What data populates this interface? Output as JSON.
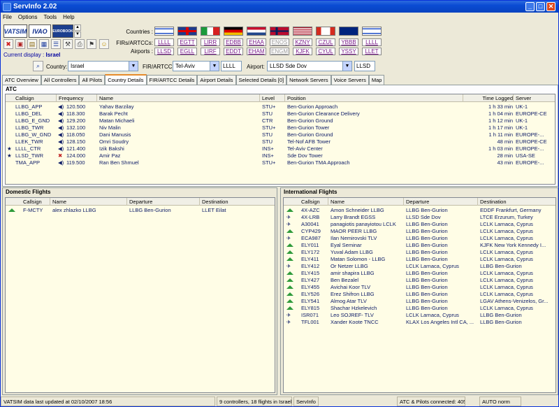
{
  "title": "ServInfo 2.02",
  "menu": [
    "File",
    "Options",
    "Tools",
    "Help"
  ],
  "window_buttons": [
    "_",
    "□",
    "✕"
  ],
  "logos": {
    "vatsim": "VATSIM",
    "ivao": "IVAO",
    "eurobook": "EUROBOOK"
  },
  "labels": {
    "countries": "Countries :",
    "firs": "FIRs/ARTCCs:",
    "airports": "Airports :",
    "current_display": "Current display :",
    "country": "Country:",
    "fir": "FIR/ARTCC:",
    "airport": "Airport:"
  },
  "current_display": "Israel",
  "firs": [
    {
      "code": "LLLL",
      "grey": false
    },
    {
      "code": "EGTT",
      "grey": false
    },
    {
      "code": "LIRR",
      "grey": false
    },
    {
      "code": "EDBB",
      "grey": false
    },
    {
      "code": "EHAA",
      "grey": false
    },
    {
      "code": "ENOS",
      "grey": true
    },
    {
      "code": "KZNY",
      "grey": false
    },
    {
      "code": "CZUL",
      "grey": false
    },
    {
      "code": "YBBB",
      "grey": false
    },
    {
      "code": "LLLL",
      "grey": false
    }
  ],
  "airports": [
    {
      "code": "LLSD",
      "grey": false
    },
    {
      "code": "EGLL",
      "grey": false
    },
    {
      "code": "LIRF",
      "grey": false
    },
    {
      "code": "EDDT",
      "grey": false
    },
    {
      "code": "EHAM",
      "grey": false
    },
    {
      "code": "ENGM",
      "grey": true
    },
    {
      "code": "KJFK",
      "grey": false
    },
    {
      "code": "CYUL",
      "grey": false
    },
    {
      "code": "YSSY",
      "grey": false
    },
    {
      "code": "LLET",
      "grey": false
    }
  ],
  "flags": [
    "israel",
    "uk",
    "italy",
    "germany",
    "netherlands",
    "norway",
    "usa",
    "canada",
    "australia",
    "israel"
  ],
  "filters": {
    "country": "Israel",
    "fir_value": "Tel-Aviv",
    "fir_code": "LLLL",
    "airport_value": "LLSD Sde Dov",
    "airport_code": "LLSD"
  },
  "tabs": [
    {
      "label": "ATC Overview",
      "active": false
    },
    {
      "label": "All Controllers",
      "active": false
    },
    {
      "label": "All Pilots",
      "active": false
    },
    {
      "label": "Country Details",
      "active": true
    },
    {
      "label": "FIR/ARTCC Details",
      "active": false
    },
    {
      "label": "Airport Details",
      "active": false
    },
    {
      "label": "Selected Details [0]",
      "active": false
    },
    {
      "label": "Network Servers",
      "active": false
    },
    {
      "label": "Voice Servers",
      "active": false
    },
    {
      "label": "Map",
      "active": false
    }
  ],
  "atc": {
    "title": "ATC",
    "columns": [
      "Callsign",
      "Frequency",
      "Name",
      "Level",
      "Position",
      "Time Logged",
      "Server"
    ],
    "rows": [
      {
        "star": false,
        "callsign": "LLBG_APP",
        "mute": false,
        "freq": "120.500",
        "name": "Yahav Barzilay",
        "level": "STU+",
        "position": "Ben-Gurion Approach",
        "time": "1 h 33 min",
        "server": "UK-1"
      },
      {
        "star": false,
        "callsign": "LLBG_DEL",
        "mute": false,
        "freq": "118.300",
        "name": "Barak Pecht",
        "level": "STU",
        "position": "Ben-Gurion Clearance Delivery",
        "time": "1 h 04 min",
        "server": "EUROPE-CE"
      },
      {
        "star": false,
        "callsign": "LLBG_E_GND",
        "mute": false,
        "freq": "129.200",
        "name": "Matan Michaeli",
        "level": "CTR",
        "position": "Ben-Gurion Ground",
        "time": "1 h 12 min",
        "server": "UK-1"
      },
      {
        "star": false,
        "callsign": "LLBG_TWR",
        "mute": false,
        "freq": "132.100",
        "name": "Niv Malin",
        "level": "STU+",
        "position": "Ben-Gurion Tower",
        "time": "1 h 17 min",
        "server": "UK-1"
      },
      {
        "star": false,
        "callsign": "LLBG_W_GND",
        "mute": false,
        "freq": "118.050",
        "name": "Dani Manusis",
        "level": "STU",
        "position": "Ben-Gurion Ground",
        "time": "1 h 11 min",
        "server": "EUROPE-..."
      },
      {
        "star": false,
        "callsign": "LLEK_TWR",
        "mute": false,
        "freq": "128.150",
        "name": "Omri Soudry",
        "level": "STU",
        "position": "Tel-Nof AFB Tower",
        "time": "48 min",
        "server": "EUROPE-CE"
      },
      {
        "star": true,
        "callsign": "LLLL_CTR",
        "mute": false,
        "freq": "121.400",
        "name": "Izik Bakshi",
        "level": "INS+",
        "position": "Tel-Aviv Center",
        "time": "1 h 03 min",
        "server": "EUROPE-..."
      },
      {
        "star": true,
        "callsign": "LLSD_TWR",
        "mute": true,
        "freq": "124.000",
        "name": "Amir Paz",
        "level": "INS+",
        "position": "Sde Dov Tower",
        "time": "28 min",
        "server": "USA-SE"
      },
      {
        "star": false,
        "callsign": "TMA_APP",
        "mute": false,
        "freq": "119.500",
        "name": "Ran Ben Shmuel",
        "level": "STU+",
        "position": "Ben-Gurion TMA Approach",
        "time": "43 min",
        "server": "EUROPE-..."
      }
    ]
  },
  "domestic": {
    "title": "Domestic Flights",
    "columns": [
      "Callsign",
      "Name",
      "Departure",
      "Destination"
    ],
    "rows": [
      {
        "icon": "up",
        "callsign": "F-MCTY",
        "name": "alex zhlazko LLBG",
        "dep": "LLBG Ben-Gurion",
        "dest": "LLET Eilat"
      }
    ]
  },
  "international": {
    "title": "International Flights",
    "columns": [
      "Callsign",
      "Name",
      "Departure",
      "Destination"
    ],
    "rows": [
      {
        "icon": "up",
        "callsign": "4X-AZC",
        "name": "Amon Schneider LLBG",
        "dep": "LLBG Ben-Gurion",
        "dest": "EDDF Frankfurt, Germany"
      },
      {
        "icon": "air",
        "callsign": "4X-LRB",
        "name": "Larry Brandt EGSS",
        "dep": "LLSD Sde Dov",
        "dest": "LTCE Erzurum, Turkey"
      },
      {
        "icon": "air",
        "callsign": "A30041",
        "name": "panagiotis panayiotou LCLK",
        "dep": "LLBG Ben-Gurion",
        "dest": "LCLK Larnaca, Cyprus"
      },
      {
        "icon": "up",
        "callsign": "CYP429",
        "name": "MAOR PEER LLBG",
        "dep": "LLBG Ben-Gurion",
        "dest": "LCLK Larnaca, Cyprus"
      },
      {
        "icon": "air",
        "callsign": "ECA987",
        "name": "Ilan Nemirovski TLV",
        "dep": "LLBG Ben-Gurion",
        "dest": "LCLK Larnaca, Cyprus"
      },
      {
        "icon": "up",
        "callsign": "ELY011",
        "name": "Eyal Seminar",
        "dep": "LLBG Ben-Gurion",
        "dest": "KJFK New York Kennedy I..."
      },
      {
        "icon": "up",
        "callsign": "ELY172",
        "name": "Yuval Adam LLBG",
        "dep": "LLBG Ben-Gurion",
        "dest": "LCLK Larnaca, Cyprus"
      },
      {
        "icon": "up",
        "callsign": "ELY411",
        "name": "Matan Solomon - LLBG",
        "dep": "LLBG Ben-Gurion",
        "dest": "LCLK Larnaca, Cyprus"
      },
      {
        "icon": "air",
        "callsign": "ELY412",
        "name": "Or Netzer LLBG",
        "dep": "LCLK Larnaca, Cyprus",
        "dest": "LLBG Ben-Gurion"
      },
      {
        "icon": "up",
        "callsign": "ELY415",
        "name": "amir shapira LLBG",
        "dep": "LLBG Ben-Gurion",
        "dest": "LCLK Larnaca, Cyprus"
      },
      {
        "icon": "up",
        "callsign": "ELY427",
        "name": "Ben Bezalel",
        "dep": "LLBG Ben-Gurion",
        "dest": "LCLK Larnaca, Cyprus"
      },
      {
        "icon": "up",
        "callsign": "ELY455",
        "name": "Avichai Koor TLV",
        "dep": "LLBG Ben-Gurion",
        "dest": "LCLK Larnaca, Cyprus"
      },
      {
        "icon": "up",
        "callsign": "ELY526",
        "name": "Erez Shifron LLBG",
        "dep": "LLBG Ben-Gurion",
        "dest": "LCLK Larnaca, Cyprus"
      },
      {
        "icon": "up",
        "callsign": "ELY541",
        "name": "Almog Atar TLV",
        "dep": "LLBG Ben-Gurion",
        "dest": "LGAV Athens-Venizelos, Gr..."
      },
      {
        "icon": "up",
        "callsign": "ELY815",
        "name": "Shachar Hzkelevich",
        "dep": "LLBG Ben-Gurion",
        "dest": "LCLK Larnaca, Cyprus"
      },
      {
        "icon": "air",
        "callsign": "ISR071",
        "name": "Leo SOJREF- TLV",
        "dep": "LCLK Larnaca, Cyprus",
        "dest": "LLBG Ben-Gurion"
      },
      {
        "icon": "air",
        "callsign": "TFL001",
        "name": "Xander Koote TNCC",
        "dep": "KLAX Los Angeles Intl CA, ...",
        "dest": "LLBG Ben-Gurion"
      }
    ]
  },
  "status": {
    "updated": "VATSIM data last updated at 02/10/2007 18:56",
    "summary": "9 controllers, 18 flights in Israel",
    "app": "ServInfo",
    "connected": "ATC & Pilots connected: 405",
    "mode": "AUTO norm"
  }
}
